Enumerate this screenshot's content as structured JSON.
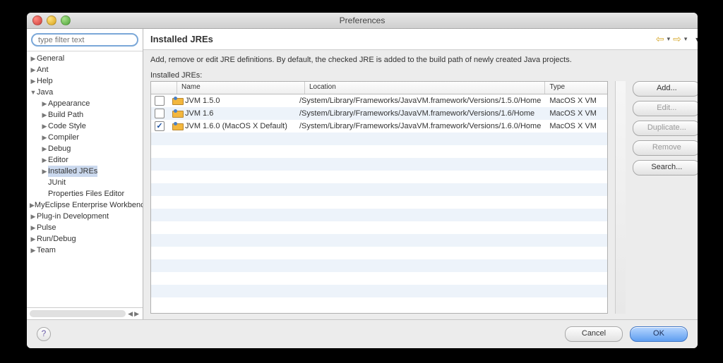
{
  "window": {
    "title": "Preferences"
  },
  "filter": {
    "placeholder": "type filter text"
  },
  "sidebar": {
    "items": [
      {
        "label": "General",
        "depth": 0,
        "expanded": false,
        "hasChildren": true
      },
      {
        "label": "Ant",
        "depth": 0,
        "expanded": false,
        "hasChildren": true
      },
      {
        "label": "Help",
        "depth": 0,
        "expanded": false,
        "hasChildren": true
      },
      {
        "label": "Java",
        "depth": 0,
        "expanded": true,
        "hasChildren": true
      },
      {
        "label": "Appearance",
        "depth": 1,
        "expanded": false,
        "hasChildren": true
      },
      {
        "label": "Build Path",
        "depth": 1,
        "expanded": false,
        "hasChildren": true
      },
      {
        "label": "Code Style",
        "depth": 1,
        "expanded": false,
        "hasChildren": true
      },
      {
        "label": "Compiler",
        "depth": 1,
        "expanded": false,
        "hasChildren": true
      },
      {
        "label": "Debug",
        "depth": 1,
        "expanded": false,
        "hasChildren": true
      },
      {
        "label": "Editor",
        "depth": 1,
        "expanded": false,
        "hasChildren": true
      },
      {
        "label": "Installed JREs",
        "depth": 1,
        "expanded": false,
        "hasChildren": true,
        "selected": true
      },
      {
        "label": "JUnit",
        "depth": 1,
        "expanded": false,
        "hasChildren": false
      },
      {
        "label": "Properties Files Editor",
        "depth": 1,
        "expanded": false,
        "hasChildren": false
      },
      {
        "label": "MyEclipse Enterprise Workbench",
        "depth": 0,
        "expanded": false,
        "hasChildren": true
      },
      {
        "label": "Plug-in Development",
        "depth": 0,
        "expanded": false,
        "hasChildren": true
      },
      {
        "label": "Pulse",
        "depth": 0,
        "expanded": false,
        "hasChildren": true
      },
      {
        "label": "Run/Debug",
        "depth": 0,
        "expanded": false,
        "hasChildren": true
      },
      {
        "label": "Team",
        "depth": 0,
        "expanded": false,
        "hasChildren": true
      }
    ]
  },
  "page": {
    "title": "Installed JREs",
    "description": "Add, remove or edit JRE definitions. By default, the checked JRE is added to the build path of newly created Java projects.",
    "tableLabel": "Installed JREs:",
    "columns": {
      "name": "Name",
      "location": "Location",
      "type": "Type"
    },
    "rows": [
      {
        "checked": false,
        "name": "JVM 1.5.0",
        "location": "/System/Library/Frameworks/JavaVM.framework/Versions/1.5.0/Home",
        "type": "MacOS X VM"
      },
      {
        "checked": false,
        "name": "JVM 1.6",
        "location": "/System/Library/Frameworks/JavaVM.framework/Versions/1.6/Home",
        "type": "MacOS X VM"
      },
      {
        "checked": true,
        "name": "JVM 1.6.0 (MacOS X Default)",
        "location": "/System/Library/Frameworks/JavaVM.framework/Versions/1.6.0/Home",
        "type": "MacOS X VM"
      }
    ],
    "buttons": {
      "add": "Add...",
      "edit": "Edit...",
      "duplicate": "Duplicate...",
      "remove": "Remove",
      "search": "Search..."
    }
  },
  "footer": {
    "cancel": "Cancel",
    "ok": "OK"
  }
}
